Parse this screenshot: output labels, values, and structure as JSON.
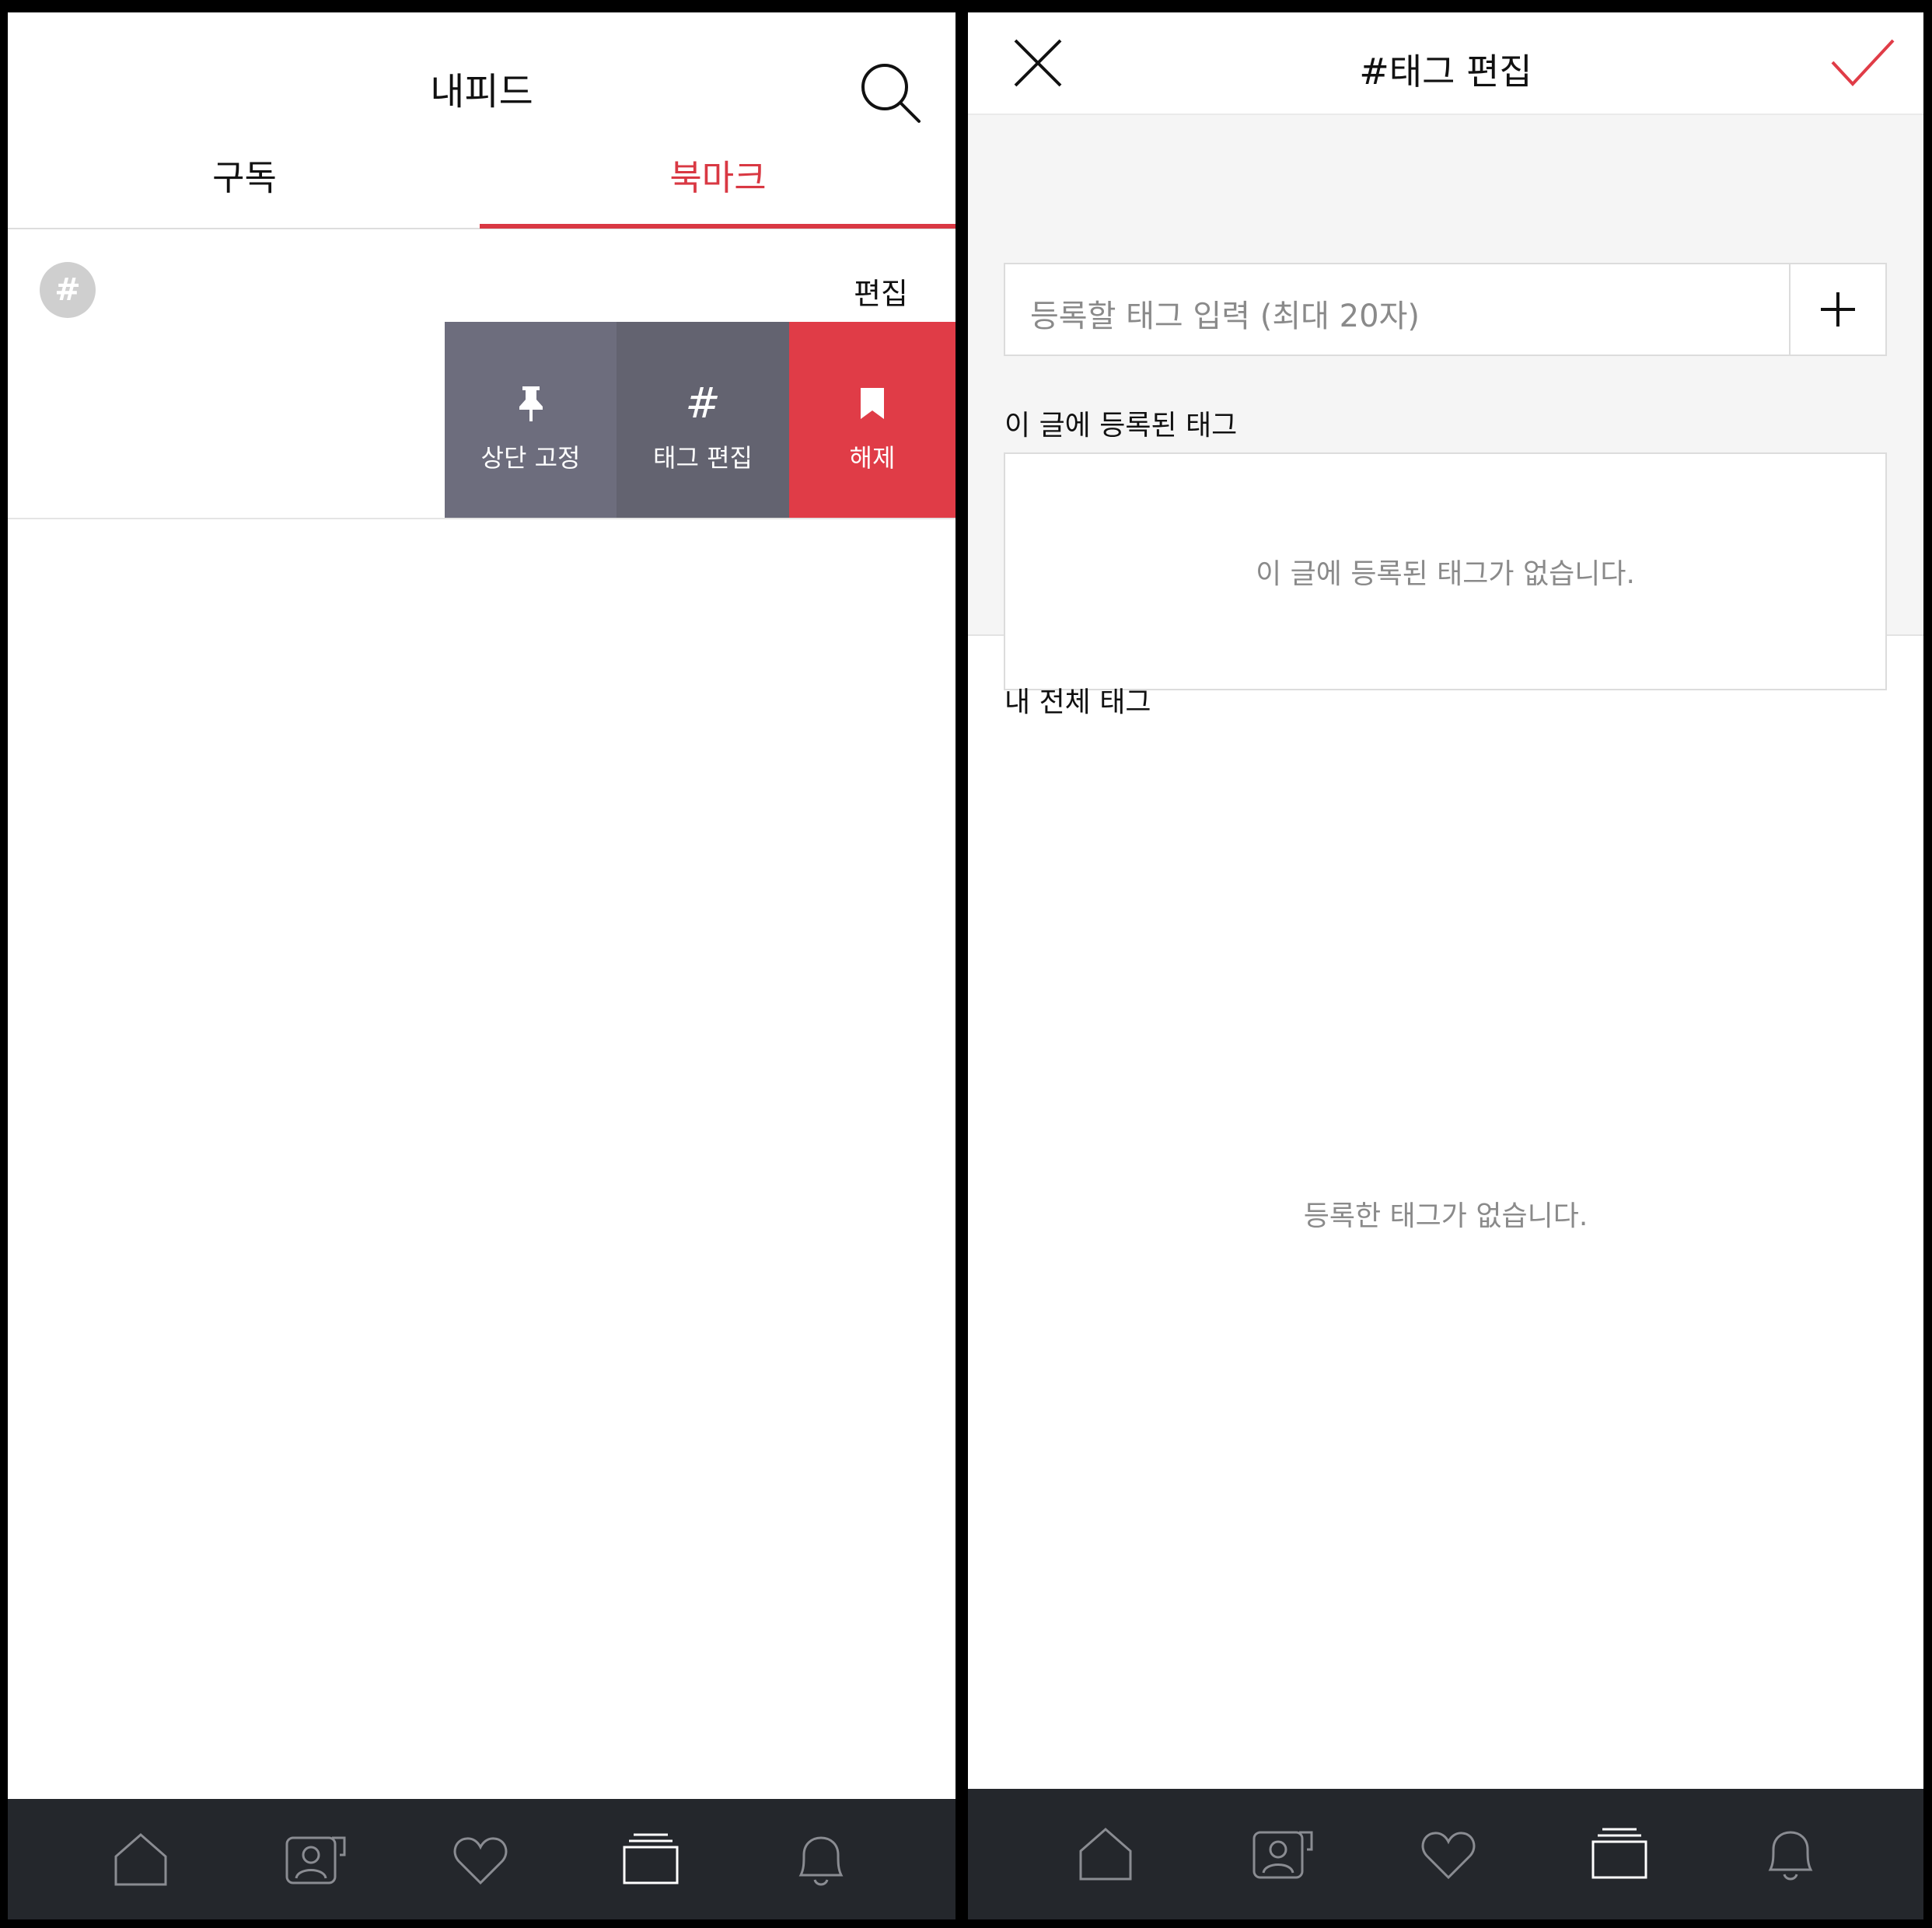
{
  "left": {
    "header": {
      "title": "내피드"
    },
    "tabs": [
      {
        "label": "구독",
        "active": false
      },
      {
        "label": "북마크",
        "active": true
      }
    ],
    "tag_filter": {
      "hash_symbol": "#",
      "edit_label": "편집"
    },
    "swipe_actions": {
      "pin_label": "상단 고정",
      "tag_icon_text": "#",
      "tag_edit_label": "태그 편집",
      "unbookmark_label": "해제"
    }
  },
  "right": {
    "header": {
      "title": "#태그 편집"
    },
    "tag_input": {
      "placeholder": "등록할 태그 입력 (최대 20자)"
    },
    "post_tags": {
      "section_title": "이 글에 등록된 태그",
      "empty_text": "이 글에 등록된 태그가 없습니다."
    },
    "all_tags": {
      "section_title": "내 전체 태그",
      "empty_text": "등록한 태그가 없습니다."
    }
  },
  "bottom_nav": {
    "items": [
      "home-icon",
      "profile-card-icon",
      "heart-icon",
      "stack-icon",
      "bell-icon"
    ],
    "active": "stack-icon"
  },
  "colors": {
    "accent": "#d93843",
    "pin_action": "#6d6d7d",
    "tag_action": "#636370",
    "unbookmark_action": "#e03c47",
    "nav_bar": "#24272c"
  }
}
